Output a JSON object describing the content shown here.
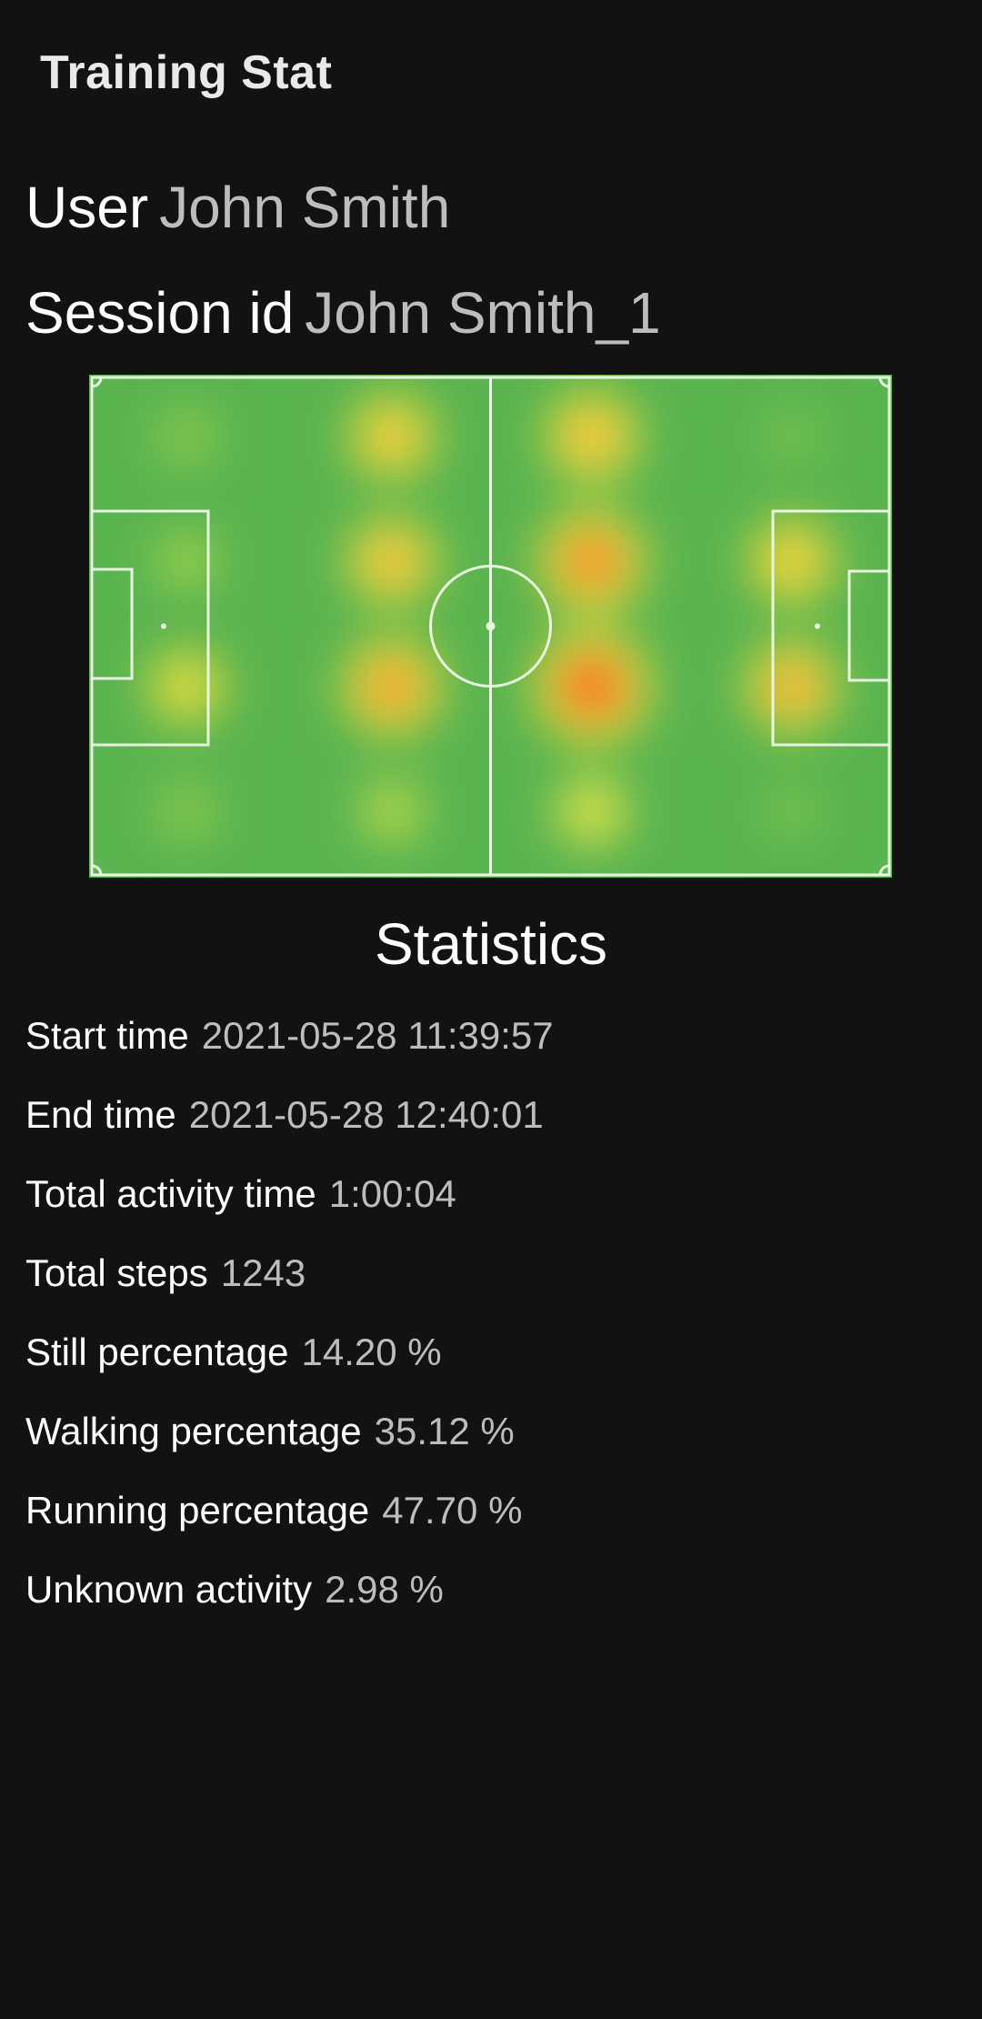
{
  "app_bar": {
    "title": "Training Stat"
  },
  "user": {
    "label": "User",
    "value": "John Smith"
  },
  "session": {
    "label": "Session id",
    "value": "John Smith_1"
  },
  "heatmap": {
    "pitch_color": "#5ab450",
    "line_color": "#e8f5e0"
  },
  "stats": {
    "heading": "Statistics",
    "rows": [
      {
        "label": "Start time",
        "value": "2021-05-28 11:39:57"
      },
      {
        "label": "End time",
        "value": "2021-05-28 12:40:01"
      },
      {
        "label": "Total activity time",
        "value": "1:00:04"
      },
      {
        "label": "Total steps",
        "value": "1243"
      },
      {
        "label": "Still percentage",
        "value": "14.20 %"
      },
      {
        "label": "Walking percentage",
        "value": "35.12 %"
      },
      {
        "label": "Running percentage",
        "value": "47.70 %"
      },
      {
        "label": "Unknown activity",
        "value": "2.98 %"
      }
    ]
  }
}
